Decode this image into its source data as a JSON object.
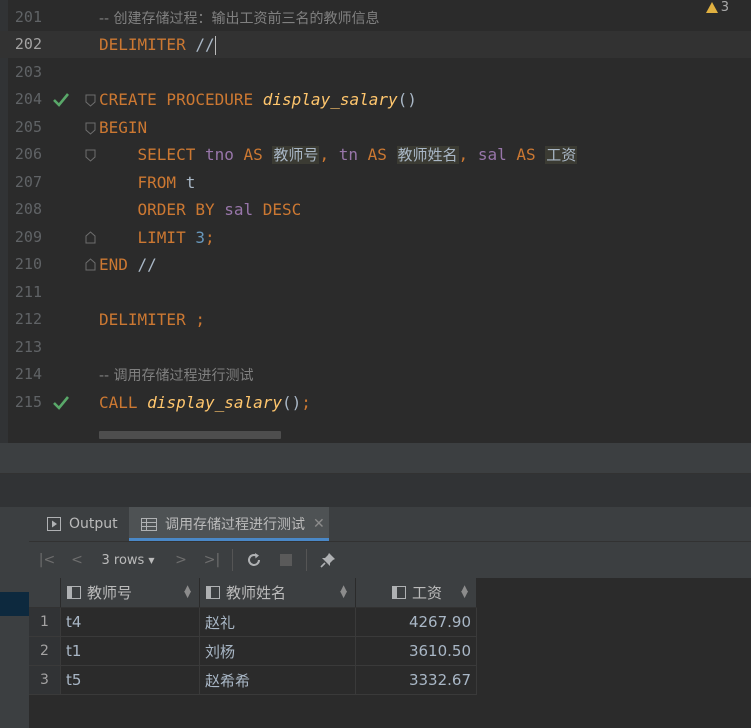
{
  "editor": {
    "warning_count": "3",
    "lines": [
      {
        "num": "201",
        "comment": "-- 创建存储过程：输出工资前三名的教师信息"
      },
      {
        "num": "202",
        "kw": "DELIMITER",
        "text": " //"
      },
      {
        "num": "203"
      },
      {
        "num": "204",
        "kw": "CREATE PROCEDURE",
        "fn": "display_salary",
        "text": "()"
      },
      {
        "num": "205",
        "kw": "BEGIN"
      },
      {
        "num": "206",
        "kw1": "SELECT",
        "col1": "tno",
        "kw2": "AS",
        "a1": "教师号",
        "p1": ",",
        "col2": "tn",
        "kw3": "AS",
        "a2": "教师姓名",
        "p2": ",",
        "col3": "sal",
        "kw4": "AS",
        "a3": "工资"
      },
      {
        "num": "207",
        "kw": "FROM",
        "text": " t"
      },
      {
        "num": "208",
        "kw1": "ORDER BY",
        "col": "sal",
        "kw2": "DESC"
      },
      {
        "num": "209",
        "kw": "LIMIT",
        "n": "3",
        "p": ";"
      },
      {
        "num": "210",
        "kw": "END",
        "text": " //"
      },
      {
        "num": "211"
      },
      {
        "num": "212",
        "kw": "DELIMITER",
        "p": " ;"
      },
      {
        "num": "213"
      },
      {
        "num": "214",
        "comment": "-- 调用存储过程进行测试"
      },
      {
        "num": "215",
        "kw": "CALL",
        "fn": "display_salary",
        "text": "()",
        "p": ";"
      }
    ]
  },
  "tabs": {
    "output_label": "Output",
    "result_label": "调用存储过程进行测试"
  },
  "toolbar": {
    "rows_label": "3 rows"
  },
  "grid": {
    "columns": [
      "教师号",
      "教师姓名",
      "工资"
    ],
    "rows": [
      {
        "n": "1",
        "tno": "t4",
        "tn": "赵礼",
        "sal": "4267.90"
      },
      {
        "n": "2",
        "tno": "t1",
        "tn": "刘杨",
        "sal": "3610.50"
      },
      {
        "n": "3",
        "tno": "t5",
        "tn": "赵希希",
        "sal": "3332.67"
      }
    ]
  },
  "colors": {
    "keyword": "#cc7832",
    "function": "#ffc66d",
    "column": "#9876aa",
    "number": "#6897bb",
    "comment": "#808080",
    "check": "#59a869",
    "accent": "#4a88c7"
  },
  "icons": [
    "warning-icon",
    "checkmark-icon",
    "fold-icon",
    "play-output-icon",
    "table-icon",
    "close-icon",
    "first-page-icon",
    "prev-page-icon",
    "next-page-icon",
    "last-page-icon",
    "refresh-icon",
    "stop-icon",
    "pin-icon",
    "sort-icon"
  ]
}
